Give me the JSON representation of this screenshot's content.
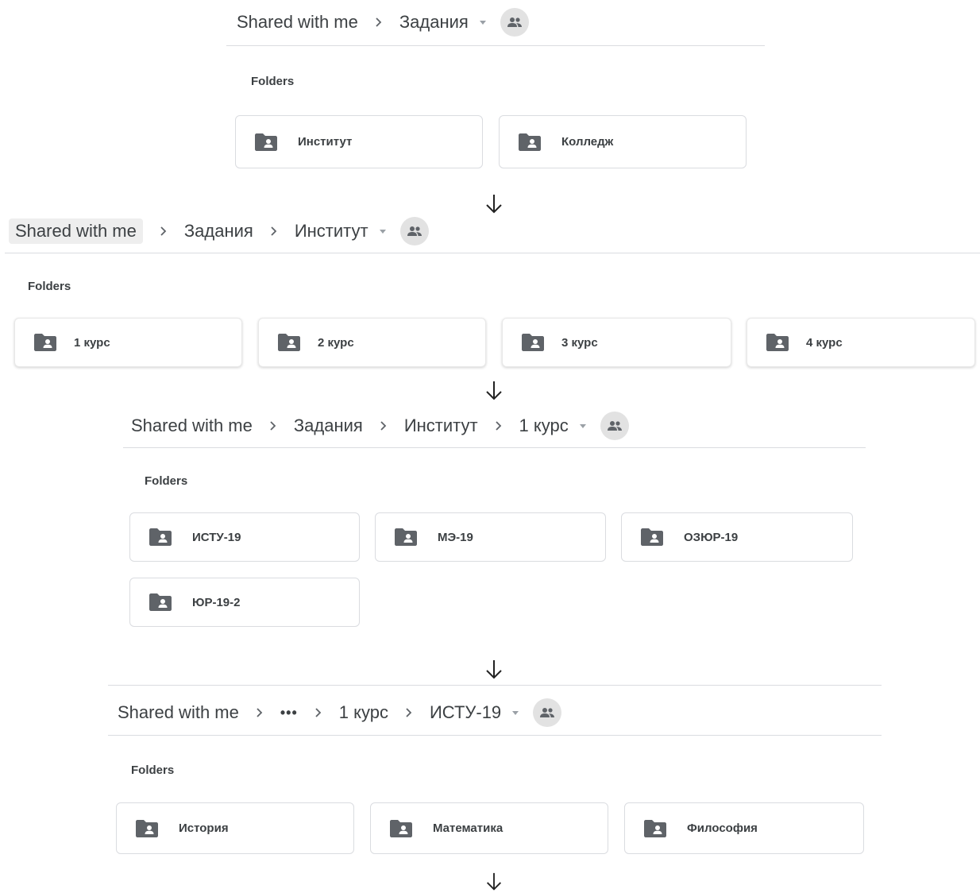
{
  "sections_label": "Folders",
  "screens": [
    {
      "breadcrumb": [
        "Shared with me",
        "Задания"
      ],
      "folders": [
        "Институт",
        "Колледж"
      ]
    },
    {
      "breadcrumb": [
        "Shared with me",
        "Задания",
        "Институт"
      ],
      "folders": [
        "1 курс",
        "2 курс",
        "3 курс",
        "4 курс"
      ]
    },
    {
      "breadcrumb": [
        "Shared with me",
        "Задания",
        "Институт",
        "1 курс"
      ],
      "folders": [
        "ИСТУ-19",
        "МЭ-19",
        "ОЗЮР-19",
        "ЮР-19-2"
      ]
    },
    {
      "breadcrumb": [
        "Shared with me",
        "•••",
        "1 курс",
        "ИСТУ-19"
      ],
      "folders": [
        "История",
        "Математика",
        "Философия"
      ]
    }
  ],
  "icons": {
    "folder": "shared-folder-icon",
    "share": "people-icon",
    "separator": "chevron-right-icon",
    "menu": "dropdown-caret-icon",
    "flow": "arrow-down-icon"
  },
  "colors": {
    "text": "#3c4043",
    "divider": "#dadce0",
    "icon": "#5f6368",
    "share_bg": "#e2e2e2"
  }
}
